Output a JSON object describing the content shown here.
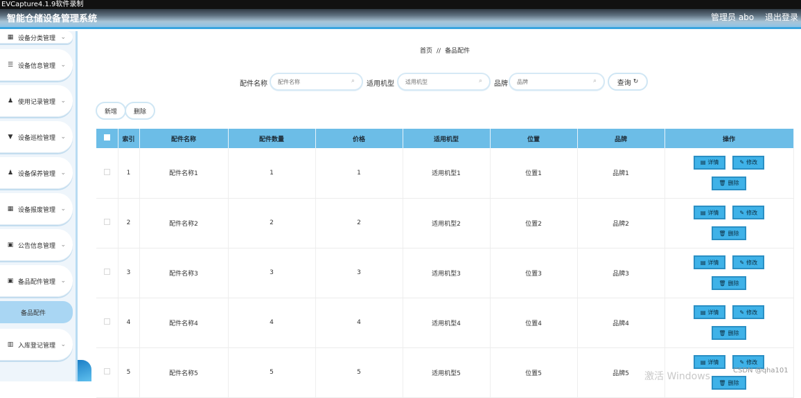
{
  "capture": {
    "title": "EVCapture4.1.9软件录制"
  },
  "header": {
    "app_title": "智能仓储设备管理系统",
    "user_label": "管理员 abo",
    "logout_label": "退出登录"
  },
  "sidebar": {
    "items": [
      {
        "label": "设备分类管理",
        "icon": "grid-icon",
        "glyph": "▦"
      },
      {
        "label": "设备信息管理",
        "icon": "list-icon",
        "glyph": "☰"
      },
      {
        "label": "使用记录管理",
        "icon": "user-icon",
        "glyph": "👤"
      },
      {
        "label": "设备巡检管理",
        "icon": "comment-icon",
        "glyph": "▼"
      },
      {
        "label": "设备保养管理",
        "icon": "user-icon",
        "glyph": "👤"
      },
      {
        "label": "设备报废管理",
        "icon": "grid-icon",
        "glyph": "▦"
      },
      {
        "label": "公告信息管理",
        "icon": "clipboard-icon",
        "glyph": "▣"
      },
      {
        "label": "备品配件管理",
        "icon": "briefcase-icon",
        "glyph": "▣"
      }
    ],
    "active_sub": "备品配件",
    "last_item": {
      "label": "入库登记管理",
      "icon": "table-icon",
      "glyph": "▥"
    }
  },
  "main": {
    "breadcrumb": {
      "home": "首页",
      "sep": "//",
      "current": "备品配件"
    },
    "search": {
      "name_label": "配件名称",
      "name_placeholder": "配件名称",
      "model_label": "适用机型",
      "model_placeholder": "适用机型",
      "brand_label": "品牌",
      "brand_placeholder": "品牌",
      "query_label": "查询"
    },
    "actions": {
      "add_label": "新增",
      "delete_label": "删除"
    },
    "table": {
      "headers": [
        "",
        "索引",
        "配件名称",
        "配件数量",
        "价格",
        "适用机型",
        "位置",
        "品牌",
        "操作"
      ],
      "rows": [
        {
          "idx": "1",
          "name": "配件名称1",
          "qty": "1",
          "price": "1",
          "model": "适用机型1",
          "location": "位置1",
          "brand": "品牌1"
        },
        {
          "idx": "2",
          "name": "配件名称2",
          "qty": "2",
          "price": "2",
          "model": "适用机型2",
          "location": "位置2",
          "brand": "品牌2"
        },
        {
          "idx": "3",
          "name": "配件名称3",
          "qty": "3",
          "price": "3",
          "model": "适用机型3",
          "location": "位置3",
          "brand": "品牌3"
        },
        {
          "idx": "4",
          "name": "配件名称4",
          "qty": "4",
          "price": "4",
          "model": "适用机型4",
          "location": "位置4",
          "brand": "品牌4"
        },
        {
          "idx": "5",
          "name": "配件名称5",
          "qty": "5",
          "price": "5",
          "model": "适用机型5",
          "location": "位置5",
          "brand": "品牌5"
        }
      ],
      "op_labels": {
        "detail": "详情",
        "edit": "修改",
        "delete": "删除"
      }
    }
  },
  "overlay": {
    "watermark": "激活 Windows",
    "csdn": "CSDN @qha101"
  }
}
